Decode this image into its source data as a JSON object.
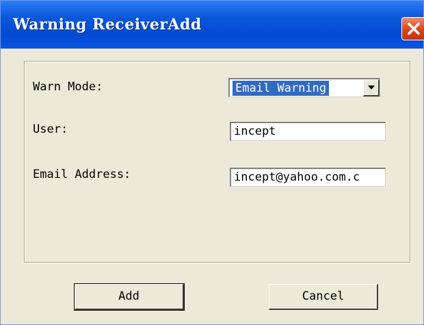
{
  "window": {
    "title": "Warning ReceiverAdd"
  },
  "form": {
    "warn_mode_label": "Warn Mode:",
    "warn_mode_value": "Email Warning",
    "user_label": "User:",
    "user_value": "incept",
    "email_label": "Email Address:",
    "email_value": "incept@yahoo.com.c"
  },
  "buttons": {
    "add_label": "Add",
    "cancel_label": "Cancel"
  },
  "icons": {
    "close": "close-icon",
    "dropdown": "chevron-down-icon"
  },
  "colors": {
    "titlebar": "#0249d1",
    "selection": "#316ac5",
    "close_button": "#d9441a",
    "window_background": "#ece9d8"
  }
}
